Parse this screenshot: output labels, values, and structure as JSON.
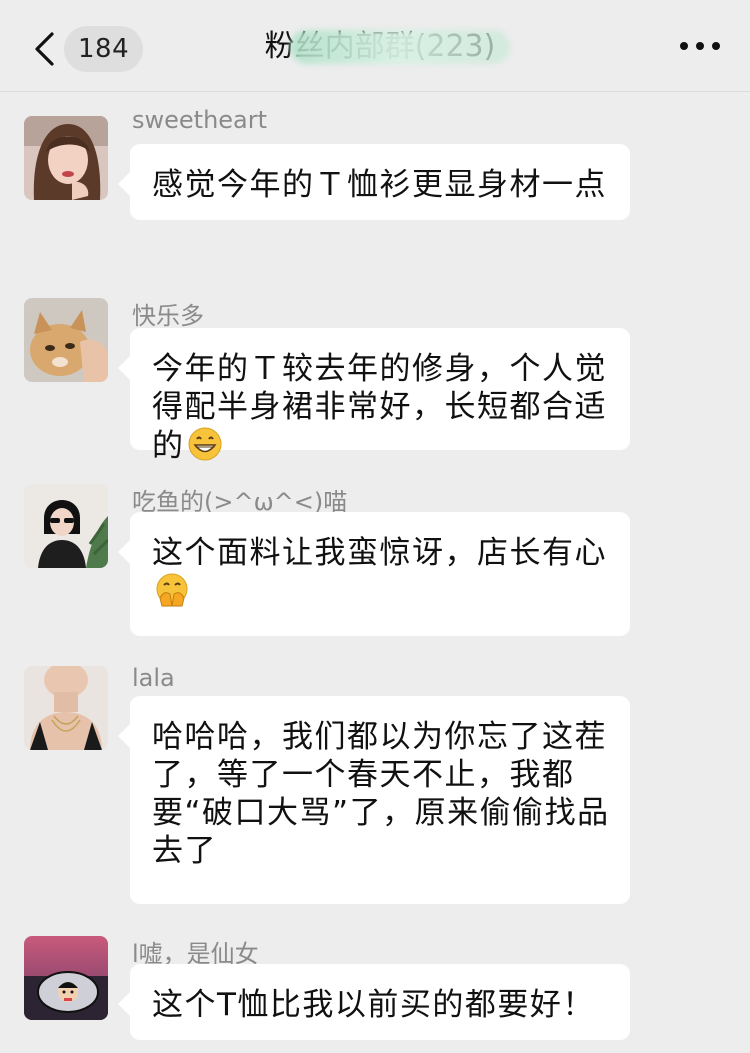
{
  "header": {
    "unread_count": "184",
    "title": "粉丝内部群(223)"
  },
  "messages": [
    {
      "sender": "sweetheart",
      "text": "感觉今年的Ｔ恤衫更显身材一点",
      "avatar": "woman-portrait-icon"
    },
    {
      "sender": "快乐多",
      "text": "今年的Ｔ较去年的修身，个人觉得配半身裙非常好，长短都合适的",
      "emoji": "grinning-face-icon",
      "avatar": "cat-icon"
    },
    {
      "sender": "吃鱼的(>^ω^<)喵",
      "text": "这个面料让我蛮惊讶，店长有心",
      "emoji": "face-with-hand-over-mouth-icon",
      "avatar": "sunglasses-girl-icon"
    },
    {
      "sender": "lala",
      "text": "哈哈哈，我们都以为你忘了这茬了，等了一个春天不止，我都要“破口大骂”了，原来偷偷找品去了",
      "avatar": "neck-portrait-icon"
    },
    {
      "sender": "l嘘，是仙女",
      "text": "这个T恤比我以前买的都要好！",
      "avatar": "mirror-cartoon-icon"
    }
  ]
}
